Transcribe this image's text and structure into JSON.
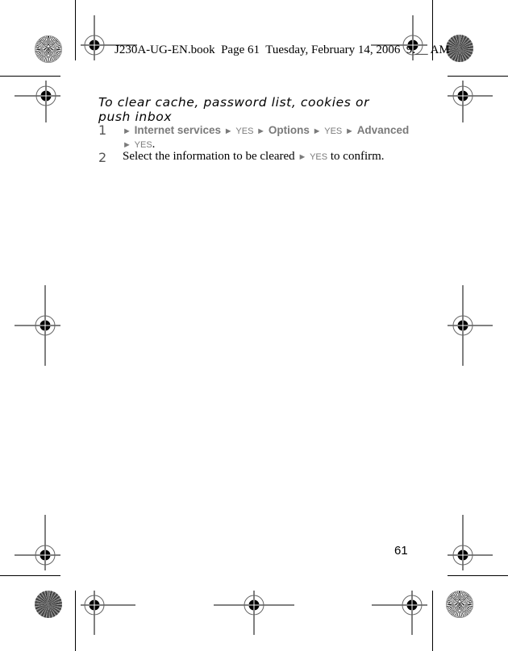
{
  "header": {
    "book_info": "J230A-UG-EN.book  Page 61  Tuesday, February 14, 2006  9:__ AM"
  },
  "section": {
    "title": "To clear cache, password list, cookies or push inbox"
  },
  "steps": [
    {
      "number": "1",
      "items": [
        "Internet services",
        "YES",
        "Options",
        "YES",
        "Advanced",
        "YES"
      ],
      "suffix": "."
    },
    {
      "number": "2",
      "text_before": "Select the information to be cleared",
      "key": "YES",
      "text_after": "to confirm."
    }
  ],
  "glyphs": {
    "arrow": "►"
  },
  "footer": {
    "page_number": "61"
  },
  "icons": [
    "registration-mark-icon",
    "color-rosette-icon",
    "crop-mark"
  ]
}
